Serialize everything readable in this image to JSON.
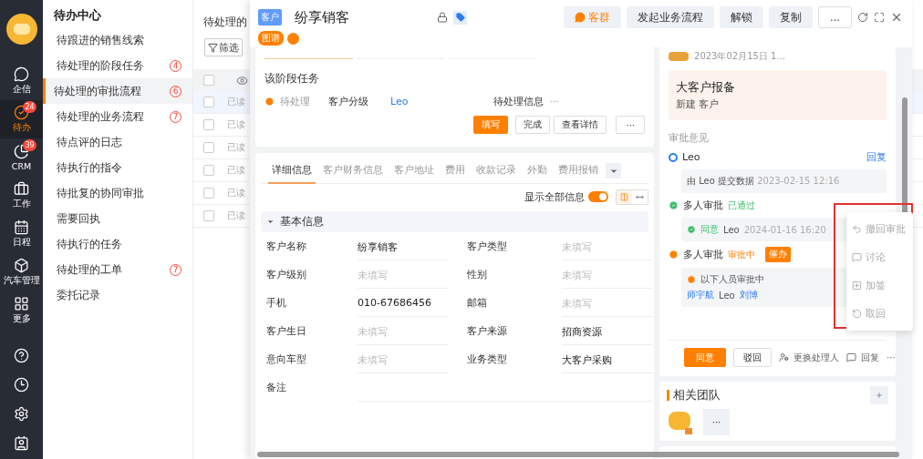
{
  "nav": {
    "items": [
      {
        "label": "企信",
        "selected": false
      },
      {
        "label": "待办",
        "selected": true,
        "badge": "24"
      },
      {
        "label": "CRM",
        "selected": false,
        "badge": "39"
      },
      {
        "label": "工作",
        "selected": false
      },
      {
        "label": "日程",
        "selected": false
      },
      {
        "label": "汽车管理",
        "selected": false
      },
      {
        "label": "更多",
        "selected": false
      }
    ]
  },
  "sidebar": {
    "title": "待办中心",
    "items": [
      {
        "label": "待跟进的销售线索",
        "selected": false
      },
      {
        "label": "待处理的阶段任务",
        "selected": false,
        "badge": "4"
      },
      {
        "label": "待处理的审批流程",
        "selected": true,
        "badge": "6"
      },
      {
        "label": "待处理的业务流程",
        "selected": false,
        "badge": "7"
      },
      {
        "label": "待点评的日志",
        "selected": false
      },
      {
        "label": "待执行的指令",
        "selected": false
      },
      {
        "label": "待批复的协同审批",
        "selected": false
      },
      {
        "label": "需要回执",
        "selected": false
      },
      {
        "label": "待执行的任务",
        "selected": false
      },
      {
        "label": "待处理的工单",
        "selected": false,
        "badge": "7"
      },
      {
        "label": "委托记录",
        "selected": false
      }
    ]
  },
  "list": {
    "title": "待处理的",
    "filter": "筛选",
    "select_all": {
      "checked": false
    },
    "rows": [
      {
        "status": "已读",
        "selected": true,
        "checked": false
      },
      {
        "status": "已读",
        "selected": false,
        "checked": false
      },
      {
        "status": "已读",
        "selected": false,
        "checked": false
      },
      {
        "status": "已读",
        "selected": false,
        "checked": false
      },
      {
        "status": "已读",
        "selected": false,
        "checked": false
      },
      {
        "status": "已读",
        "selected": false,
        "checked": false
      }
    ]
  },
  "drawer": {
    "tag": "客户",
    "title": "纷享销客",
    "badge": "图谱",
    "actions": [
      "客群",
      "发起业务流程",
      "解锁",
      "复制",
      "..."
    ],
    "stage_bars": [
      {
        "selected": true
      },
      {
        "selected": false
      },
      {
        "selected": false
      }
    ],
    "stage_task": {
      "title": "该阶段任务",
      "status": "待处理",
      "name": "客户分级",
      "owner": "Leo",
      "info": "待处理信息",
      "buttons": [
        {
          "label": "填写",
          "primary": true
        },
        {
          "label": "完成",
          "primary": false
        },
        {
          "label": "查看详情",
          "primary": false
        }
      ],
      "more": "···"
    },
    "detail": {
      "tabs": [
        {
          "label": "详细信息",
          "selected": true
        },
        {
          "label": "客户财务信息",
          "selected": false
        },
        {
          "label": "客户地址",
          "selected": false
        },
        {
          "label": "费用",
          "selected": false
        },
        {
          "label": "收款记录",
          "selected": false
        },
        {
          "label": "外勤",
          "selected": false
        },
        {
          "label": "费用报销",
          "selected": false
        }
      ],
      "show_all": {
        "label": "显示全部信息",
        "on": true
      },
      "layout_modes": [
        {
          "selected": true
        },
        {
          "selected": false
        }
      ],
      "section": {
        "title": "基本信息",
        "expanded": true
      },
      "fields": [
        {
          "label": "客户名称",
          "value": "纷享销客",
          "blank": false
        },
        {
          "label": "客户类型",
          "value": "未填写",
          "blank": true
        },
        {
          "label": "客户级别",
          "value": "未填写",
          "blank": true
        },
        {
          "label": "性别",
          "value": "未填写",
          "blank": true
        },
        {
          "label": "手机",
          "value": "010-67686456",
          "blank": false
        },
        {
          "label": "邮箱",
          "value": "未填写",
          "blank": true
        },
        {
          "label": "客户生日",
          "value": "未填写",
          "blank": true
        },
        {
          "label": "客户来源",
          "value": "招商资源",
          "blank": false
        },
        {
          "label": "意向车型",
          "value": "未填写",
          "blank": true
        },
        {
          "label": "业务类型",
          "value": "大客户采购",
          "blank": false
        },
        {
          "label": "备注"
        }
      ]
    },
    "approval": {
      "date": "2023年02月15日 1...",
      "card_title": "大客户报备",
      "card_sub": "新建 客户",
      "section": "审批意见",
      "steps": [
        {
          "kind": "start",
          "name": "Leo",
          "reply": "回复",
          "text": "由 Leo 提交数据",
          "time": "2023-02-15 12:16"
        },
        {
          "kind": "passed",
          "name": "多人审批",
          "status": "已通过",
          "result": "同意",
          "person": "Leo",
          "time": "2024-01-16 16:20"
        },
        {
          "kind": "pending",
          "name": "多人审批",
          "status": "审批中",
          "urge": "催办",
          "text": "以下人员审批中",
          "people": [
            {
              "name": "师宇航",
              "link": true
            },
            {
              "name": "Leo",
              "link": false
            },
            {
              "name": "刘博",
              "link": true
            }
          ]
        }
      ],
      "approve": "同意",
      "reject": "驳回",
      "transfer": "更换处理人",
      "reply": "回复",
      "more": "···"
    },
    "menu": {
      "items": [
        "撤回审批",
        "讨论",
        "加签",
        "取回"
      ]
    },
    "team": {
      "title": "相关团队",
      "more": "···"
    }
  }
}
